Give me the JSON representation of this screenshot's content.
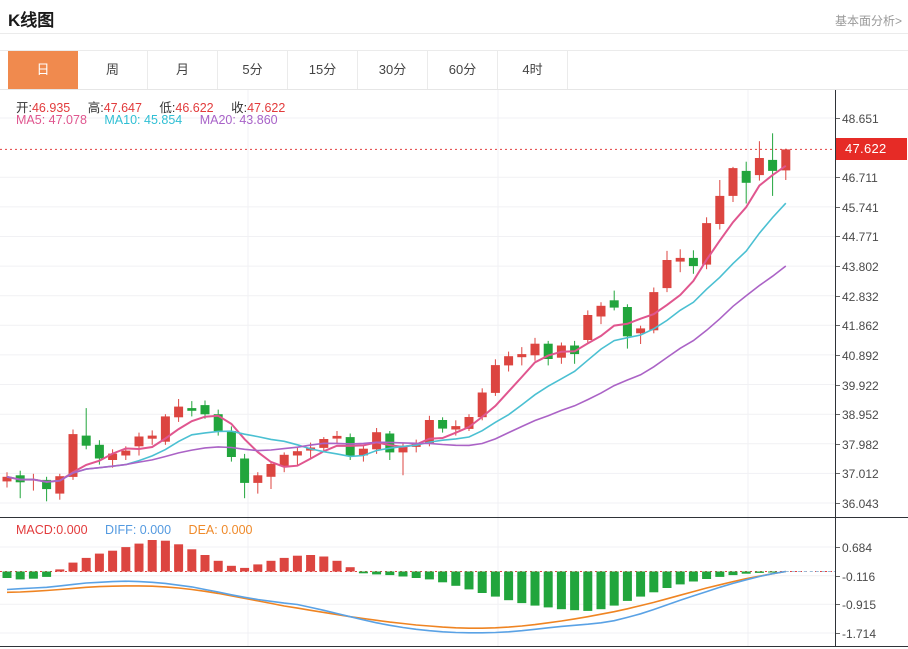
{
  "header": {
    "title": "K线图",
    "link": "基本面分析>"
  },
  "tabs": {
    "items": [
      "日",
      "周",
      "月",
      "5分",
      "15分",
      "30分",
      "60分",
      "4时"
    ],
    "selected_index": 0
  },
  "quote": {
    "open_label": "开:",
    "open": "46.935",
    "high_label": "高:",
    "high": "47.647",
    "low_label": "低:",
    "low": "46.622",
    "close_label": "收:",
    "close": "47.622"
  },
  "ma": {
    "ma5_label": "MA5:",
    "ma5": "47.078",
    "ma10_label": "MA10:",
    "ma10": "45.854",
    "ma20_label": "MA20:",
    "ma20": "43.860"
  },
  "macd_info": {
    "macd_label": "MACD:",
    "macd": "0.000",
    "diff_label": "DIFF:",
    "diff": "0.000",
    "dea_label": "DEA:",
    "dea": "0.000"
  },
  "colors": {
    "up_candle": "#dc4540",
    "down_candle": "#21a53c",
    "ma5": "#e0568f",
    "ma10": "#4bc0d2",
    "ma20": "#ab63c6",
    "diff_line": "#5aa2e5",
    "dea_line": "#ef8422",
    "price_line": "#e34040",
    "price_tag_bg": "#e62b26",
    "selected_tab_bg": "#f08a4e",
    "grid": "#f1f1f4",
    "frame": "#2f3338"
  },
  "chart_data": {
    "type": "candlestick",
    "main": {
      "current_price": 47.622,
      "current_price_label": "47.622",
      "y_axis_labels": [
        "48.651",
        "46.711",
        "45.741",
        "44.771",
        "43.802",
        "42.832",
        "41.862",
        "40.892",
        "39.922",
        "38.952",
        "37.982",
        "37.012",
        "36.043"
      ],
      "y_top_value": 48.651,
      "candles_ohlc": [
        [
          36.75,
          37.05,
          36.55,
          36.9
        ],
        [
          36.95,
          37.1,
          36.2,
          36.72
        ],
        [
          36.8,
          37.0,
          36.45,
          36.82
        ],
        [
          36.8,
          36.9,
          36.1,
          36.5
        ],
        [
          36.35,
          37.0,
          36.15,
          36.92
        ],
        [
          36.9,
          38.45,
          36.8,
          38.3
        ],
        [
          38.25,
          39.15,
          37.8,
          37.92
        ],
        [
          37.95,
          38.1,
          37.3,
          37.5
        ],
        [
          37.45,
          37.8,
          37.2,
          37.66
        ],
        [
          37.6,
          37.9,
          37.45,
          37.76
        ],
        [
          37.9,
          38.35,
          37.6,
          38.22
        ],
        [
          38.15,
          38.42,
          37.95,
          38.25
        ],
        [
          38.05,
          38.95,
          37.95,
          38.88
        ],
        [
          38.85,
          39.45,
          38.7,
          39.2
        ],
        [
          39.15,
          39.38,
          38.88,
          39.06
        ],
        [
          39.25,
          39.4,
          38.8,
          38.95
        ],
        [
          38.95,
          39.1,
          38.25,
          38.4
        ],
        [
          38.4,
          38.55,
          37.4,
          37.55
        ],
        [
          37.5,
          37.65,
          36.2,
          36.7
        ],
        [
          36.7,
          37.05,
          36.35,
          36.95
        ],
        [
          36.9,
          37.4,
          36.5,
          37.32
        ],
        [
          37.25,
          37.7,
          37.05,
          37.62
        ],
        [
          37.6,
          37.85,
          37.25,
          37.74
        ],
        [
          37.76,
          38.02,
          37.52,
          37.86
        ],
        [
          37.85,
          38.2,
          37.7,
          38.14
        ],
        [
          38.15,
          38.4,
          37.98,
          38.24
        ],
        [
          38.2,
          38.32,
          37.45,
          37.58
        ],
        [
          37.6,
          37.95,
          37.4,
          37.82
        ],
        [
          37.8,
          38.5,
          37.65,
          38.36
        ],
        [
          38.32,
          38.4,
          37.45,
          37.7
        ],
        [
          37.7,
          38.0,
          36.95,
          37.92
        ],
        [
          37.88,
          38.12,
          37.7,
          38.0
        ],
        [
          38.0,
          38.9,
          37.9,
          38.76
        ],
        [
          38.76,
          38.85,
          38.35,
          38.48
        ],
        [
          38.45,
          38.75,
          38.25,
          38.56
        ],
        [
          38.47,
          38.95,
          38.4,
          38.86
        ],
        [
          38.85,
          39.8,
          38.75,
          39.66
        ],
        [
          39.65,
          40.75,
          39.55,
          40.56
        ],
        [
          40.55,
          41.0,
          40.35,
          40.85
        ],
        [
          40.82,
          41.15,
          40.55,
          40.92
        ],
        [
          40.88,
          41.45,
          40.7,
          41.26
        ],
        [
          41.26,
          41.35,
          40.55,
          40.76
        ],
        [
          40.8,
          41.3,
          40.6,
          41.2
        ],
        [
          41.2,
          41.35,
          40.6,
          40.92
        ],
        [
          41.38,
          42.35,
          41.3,
          42.2
        ],
        [
          42.15,
          42.62,
          41.9,
          42.5
        ],
        [
          42.68,
          43.0,
          42.35,
          42.44
        ],
        [
          42.46,
          42.55,
          41.1,
          41.5
        ],
        [
          41.6,
          41.85,
          41.25,
          41.76
        ],
        [
          41.7,
          43.1,
          41.6,
          42.95
        ],
        [
          43.08,
          44.3,
          42.95,
          44.0
        ],
        [
          43.95,
          44.35,
          43.6,
          44.07
        ],
        [
          44.07,
          44.32,
          43.55,
          43.8
        ],
        [
          43.85,
          45.4,
          43.7,
          45.21
        ],
        [
          45.18,
          46.62,
          45.0,
          46.1
        ],
        [
          46.1,
          47.05,
          45.9,
          47.01
        ],
        [
          46.92,
          47.22,
          45.85,
          46.53
        ],
        [
          46.78,
          47.89,
          46.6,
          47.34
        ],
        [
          47.28,
          48.15,
          46.1,
          46.92
        ],
        [
          46.935,
          47.647,
          46.622,
          47.622
        ]
      ],
      "ma_periods": [
        5,
        10,
        20
      ]
    },
    "macd": {
      "y_axis_labels": [
        "0.684",
        "-0.116",
        "-0.915",
        "-1.714"
      ],
      "y_top_value": 0.684,
      "histogram": [
        -0.18,
        -0.22,
        -0.2,
        -0.15,
        0.06,
        0.25,
        0.38,
        0.5,
        0.58,
        0.68,
        0.78,
        0.88,
        0.86,
        0.76,
        0.62,
        0.46,
        0.3,
        0.16,
        0.1,
        0.2,
        0.3,
        0.38,
        0.44,
        0.46,
        0.42,
        0.3,
        0.12,
        -0.05,
        -0.08,
        -0.1,
        -0.14,
        -0.18,
        -0.22,
        -0.3,
        -0.4,
        -0.5,
        -0.6,
        -0.7,
        -0.8,
        -0.88,
        -0.95,
        -1.0,
        -1.05,
        -1.08,
        -1.1,
        -1.05,
        -0.95,
        -0.82,
        -0.7,
        -0.58,
        -0.46,
        -0.36,
        -0.28,
        -0.21,
        -0.15,
        -0.1,
        -0.06,
        -0.04,
        -0.02,
        0.0
      ],
      "diff": [
        -0.5,
        -0.48,
        -0.46,
        -0.44,
        -0.4,
        -0.36,
        -0.32,
        -0.3,
        -0.28,
        -0.27,
        -0.28,
        -0.3,
        -0.33,
        -0.38,
        -0.43,
        -0.5,
        -0.57,
        -0.65,
        -0.72,
        -0.78,
        -0.83,
        -0.88,
        -0.92,
        -1.0,
        -1.08,
        -1.17,
        -1.26,
        -1.35,
        -1.43,
        -1.5,
        -1.56,
        -1.61,
        -1.65,
        -1.68,
        -1.7,
        -1.71,
        -1.71,
        -1.7,
        -1.68,
        -1.65,
        -1.61,
        -1.57,
        -1.53,
        -1.5,
        -1.47,
        -1.43,
        -1.37,
        -1.28,
        -1.18,
        -1.06,
        -0.93,
        -0.8,
        -0.68,
        -0.56,
        -0.44,
        -0.33,
        -0.23,
        -0.14,
        -0.06,
        0.0
      ],
      "dea": [
        -0.58,
        -0.57,
        -0.55,
        -0.53,
        -0.5,
        -0.47,
        -0.44,
        -0.42,
        -0.41,
        -0.4,
        -0.4,
        -0.41,
        -0.43,
        -0.46,
        -0.5,
        -0.55,
        -0.61,
        -0.68,
        -0.75,
        -0.82,
        -0.89,
        -0.96,
        -1.02,
        -1.08,
        -1.14,
        -1.2,
        -1.26,
        -1.31,
        -1.36,
        -1.41,
        -1.45,
        -1.49,
        -1.52,
        -1.55,
        -1.57,
        -1.58,
        -1.58,
        -1.57,
        -1.55,
        -1.52,
        -1.48,
        -1.43,
        -1.38,
        -1.32,
        -1.26,
        -1.19,
        -1.12,
        -1.04,
        -0.95,
        -0.86,
        -0.76,
        -0.66,
        -0.56,
        -0.46,
        -0.37,
        -0.28,
        -0.2,
        -0.13,
        -0.06,
        0.0
      ]
    }
  }
}
